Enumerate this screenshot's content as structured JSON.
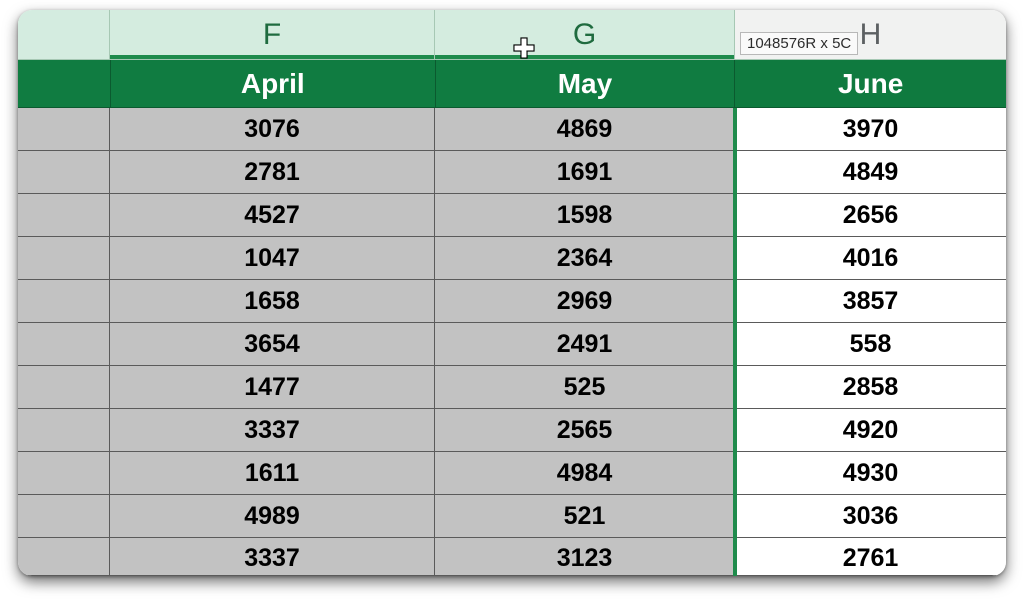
{
  "columns": {
    "F": {
      "letter": "F",
      "month": "April"
    },
    "G": {
      "letter": "G",
      "month": "May"
    },
    "H": {
      "letter": "H",
      "month": "June"
    }
  },
  "selection_tooltip": "1048576R x 5C",
  "rows": [
    {
      "F": "3076",
      "G": "4869",
      "H": "3970"
    },
    {
      "F": "2781",
      "G": "1691",
      "H": "4849"
    },
    {
      "F": "4527",
      "G": "1598",
      "H": "2656"
    },
    {
      "F": "1047",
      "G": "2364",
      "H": "4016"
    },
    {
      "F": "1658",
      "G": "2969",
      "H": "3857"
    },
    {
      "F": "3654",
      "G": "2491",
      "H": "558"
    },
    {
      "F": "1477",
      "G": "525",
      "H": "2858"
    },
    {
      "F": "3337",
      "G": "2565",
      "H": "4920"
    },
    {
      "F": "1611",
      "G": "4984",
      "H": "4930"
    },
    {
      "F": "4989",
      "G": "521",
      "H": "3036"
    },
    {
      "F": "3337",
      "G": "3123",
      "H": "2761"
    }
  ]
}
